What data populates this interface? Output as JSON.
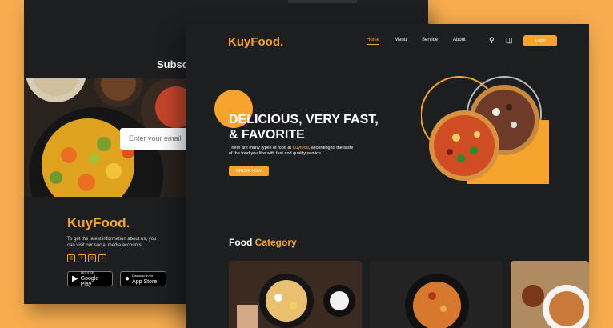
{
  "colors": {
    "accent": "#f7a42c",
    "page_bg": "#f7ac4e",
    "panel_bg": "#1d1e20"
  },
  "back": {
    "subscribe_label": "Subsc",
    "email_placeholder": "Enter your email",
    "brand": "KuyFood.",
    "info_line1": "To get the latest information about us, you",
    "info_line2": "can visit our social media accounts",
    "socials": [
      "instagram-icon",
      "facebook-icon",
      "instagram-icon",
      "twitter-icon"
    ],
    "google_play": {
      "small": "GET IT ON",
      "big": "Google Play"
    },
    "app_store": {
      "small": "Download on the",
      "big": "App Store"
    }
  },
  "front": {
    "brand": "KuyFood.",
    "nav": [
      "Home",
      "Menu",
      "Service",
      "About"
    ],
    "login": "Login",
    "hero_line1": "DELICIOUS, VERY FAST,",
    "hero_line2": "& FAVORITE",
    "desc_pre": "There are many types of food at ",
    "desc_brand": "Kuyfood",
    "desc_post": ", according to the taste",
    "desc_line2": "of the food you like with fast and quality service.",
    "order_button": "ORDER NOW",
    "category_title_1": "Food",
    "category_title_2": "Category"
  }
}
